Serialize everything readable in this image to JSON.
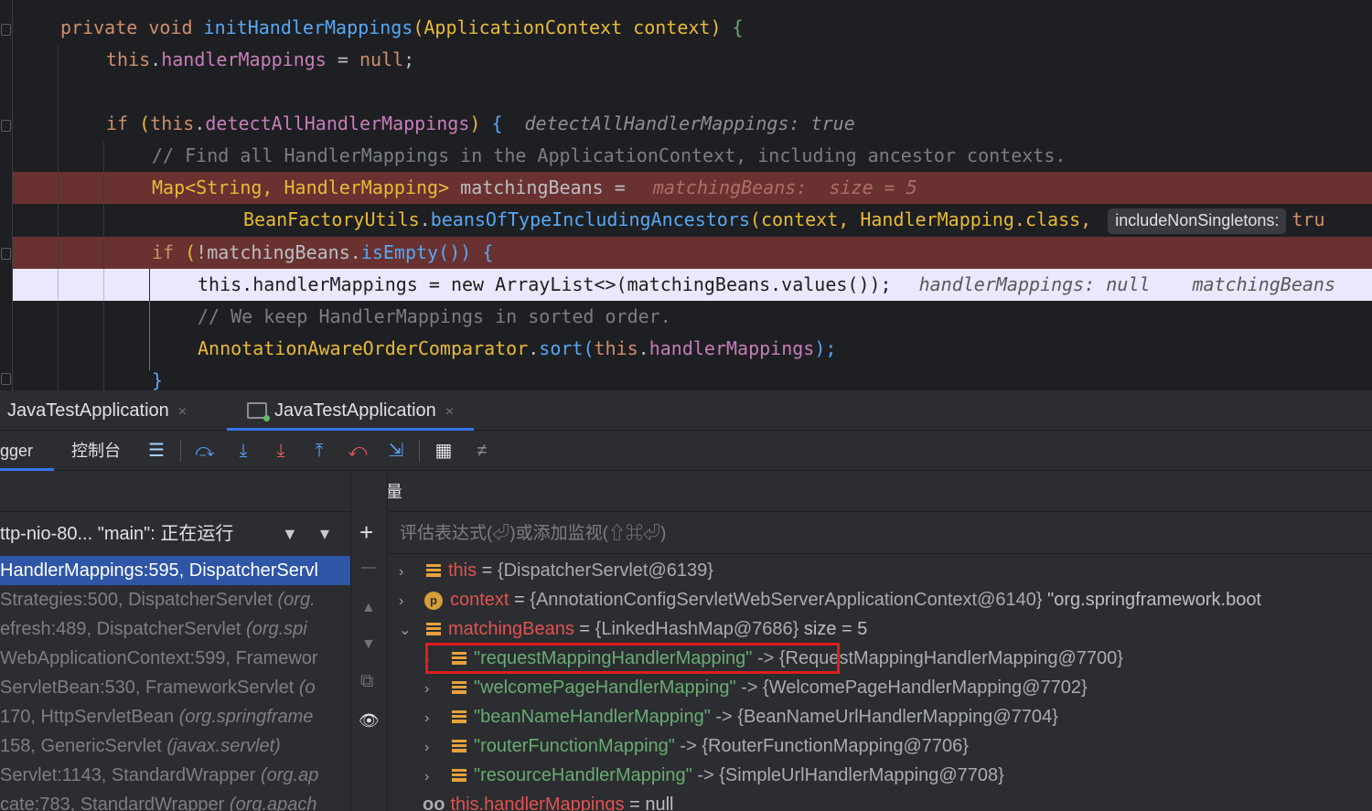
{
  "editor": {
    "lines": {
      "l1": {
        "a": "private void ",
        "b": "initHandlerMappings",
        "c": "(",
        "d": "ApplicationContext",
        "e": " context) ",
        "f": "{"
      },
      "l2": {
        "a": "this",
        "b": ".",
        "c": "handlerMappings",
        "d": " = ",
        "e": "null",
        "f": ";"
      },
      "l3": {
        "a": "if ",
        "b": "(",
        "c": "this",
        "d": ".",
        "e": "detectAllHandlerMappings",
        "f": ") ",
        "g": "{",
        "hint": "detectAllHandlerMappings: true"
      },
      "l4": {
        "a": "// Find all HandlerMappings in the ApplicationContext, including ancestor contexts."
      },
      "l5": {
        "a": "Map<String, HandlerMapping>",
        "b": " matchingBeans = ",
        "hint": "matchingBeans:  size = 5"
      },
      "l6": {
        "a": "BeanFactoryUtils",
        "b": ".",
        "c": "beansOfTypeIncludingAncestors",
        "d": "(",
        "e": "context, ",
        "f": "HandlerMapping",
        "g": ".class, ",
        "pill": "includeNonSingletons:",
        "h": "tru"
      },
      "l7": {
        "a": "if ",
        "b": "(",
        "c": "!matchingBeans.",
        "d": "isEmpty",
        "e": "()) ",
        "f": "{"
      },
      "l8": {
        "a": "this.handlerMappings = new ArrayList<>(matchingBeans.values());",
        "hint1": "handlerMappings: null",
        "hint2": "matchingBeans"
      },
      "l9": {
        "a": "// We keep HandlerMappings in sorted order."
      },
      "l10": {
        "a": "AnnotationAwareOrderComparator",
        "b": ".",
        "c": "sort",
        "d": "(",
        "e": "this",
        "f": ".",
        "g": "handlerMappings",
        "h": ");"
      },
      "l11": {
        "a": "}"
      }
    }
  },
  "run_tabs": [
    {
      "label": "JavaTestApplication",
      "close": "×"
    },
    {
      "label": "JavaTestApplication",
      "close": "×"
    }
  ],
  "toolbar": {
    "tab_debugger": "gger",
    "tab_console": "控制台",
    "icons": [
      "list-icon",
      "step-over-icon",
      "step-into-icon",
      "force-step-into-icon",
      "step-out-icon",
      "drop-frame-icon",
      "run-to-cursor-icon",
      "evaluate-icon",
      "settings-icon"
    ],
    "glyphs": [
      "☰",
      "⤼",
      "⤓",
      "⤓",
      "⤒",
      "⤺",
      "⇲",
      "▦",
      "≠"
    ]
  },
  "frames_panel": {
    "thread_label": "ttp-nio-80... \"main\": 正在运行",
    "filter_glyph": "▼",
    "dropdown_glyph": "▾",
    "frames": [
      {
        "method": "HandlerMappings:595, DispatcherServl",
        "cls": ""
      },
      {
        "method": "Strategies:500, DispatcherServlet ",
        "cls": "(org."
      },
      {
        "method": "efresh:489, DispatcherServlet ",
        "cls": "(org.spi"
      },
      {
        "method": "WebApplicationContext:599, Framewor",
        "cls": ""
      },
      {
        "method": "ServletBean:530, FrameworkServlet ",
        "cls": "(o"
      },
      {
        "method": "170, HttpServletBean ",
        "cls": "(org.springframe"
      },
      {
        "method": "158, GenericServlet ",
        "cls": "(javax.servlet)"
      },
      {
        "method": "Servlet:1143, StandardWrapper ",
        "cls": "(org.ap"
      },
      {
        "method": "cate:783, StandardWrapper ",
        "cls": "(org.apach"
      }
    ]
  },
  "side_strip": {
    "add": "+",
    "remove": "—",
    "up": "▲",
    "down": "▼",
    "copy": "⧉",
    "watch": "👁"
  },
  "variables_panel": {
    "title": "变量",
    "eval_placeholder": "评估表达式(⏎)或添加监视(⇧⌘⏎)",
    "vars": {
      "this": {
        "arrow": "›",
        "name": "this",
        "eq": " = ",
        "value": "{DispatcherServlet@6139}"
      },
      "context": {
        "arrow": "›",
        "icon": "p",
        "name": "context",
        "eq": " = ",
        "value": "{AnnotationConfigServletWebServerApplicationContext@6140} ",
        "extra": "\"org.springframework.boot"
      },
      "matchingBeans": {
        "arrow": "⌄",
        "name": "matchingBeans",
        "eq": " = ",
        "value": "{LinkedHashMap@7686}",
        "extra": "  size = 5"
      },
      "entries": [
        {
          "arrow": "›",
          "key": "\"requestMappingHandlerMapping\"",
          "value": " -> {RequestMappingHandlerMapping@7700}"
        },
        {
          "arrow": "›",
          "key": "\"welcomePageHandlerMapping\"",
          "value": " -> {WelcomePageHandlerMapping@7702}"
        },
        {
          "arrow": "›",
          "key": "\"beanNameHandlerMapping\"",
          "value": " -> {BeanNameUrlHandlerMapping@7704}"
        },
        {
          "arrow": "›",
          "key": "\"routerFunctionMapping\"",
          "value": " -> {RouterFunctionMapping@7706}"
        },
        {
          "arrow": "›",
          "key": "\"resourceHandlerMapping\"",
          "value": " -> {SimpleUrlHandlerMapping@7708}"
        }
      ],
      "handlerMappings": {
        "icon": "oo",
        "name": "this.handlerMappings",
        "eq": " = ",
        "value": "null"
      }
    }
  },
  "colors": {
    "accent": "#3574f0",
    "breakpoint_line": "#693230",
    "execution_line": "#eae8fd",
    "highlight_box": "#e01e1e",
    "selected_frame": "#2e55a6"
  }
}
